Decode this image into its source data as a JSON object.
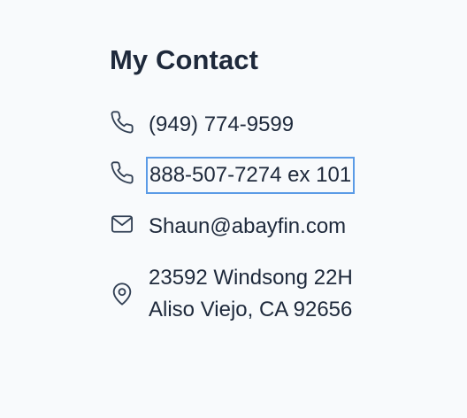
{
  "contact": {
    "title": "My Contact",
    "items": [
      {
        "icon": "phone-icon",
        "text": "(949) 774-9599"
      },
      {
        "icon": "phone-icon",
        "text": "888-507-7274 ex 101"
      },
      {
        "icon": "mail-icon",
        "text": "Shaun@abayfin.com"
      },
      {
        "icon": "map-pin-icon",
        "lines": [
          "23592 Windsong 22H",
          "Aliso Viejo, CA 92656"
        ]
      }
    ]
  },
  "colors": {
    "background": "#f8fafc",
    "text": "#1e293b",
    "focus_outline": "#5b9be6"
  }
}
